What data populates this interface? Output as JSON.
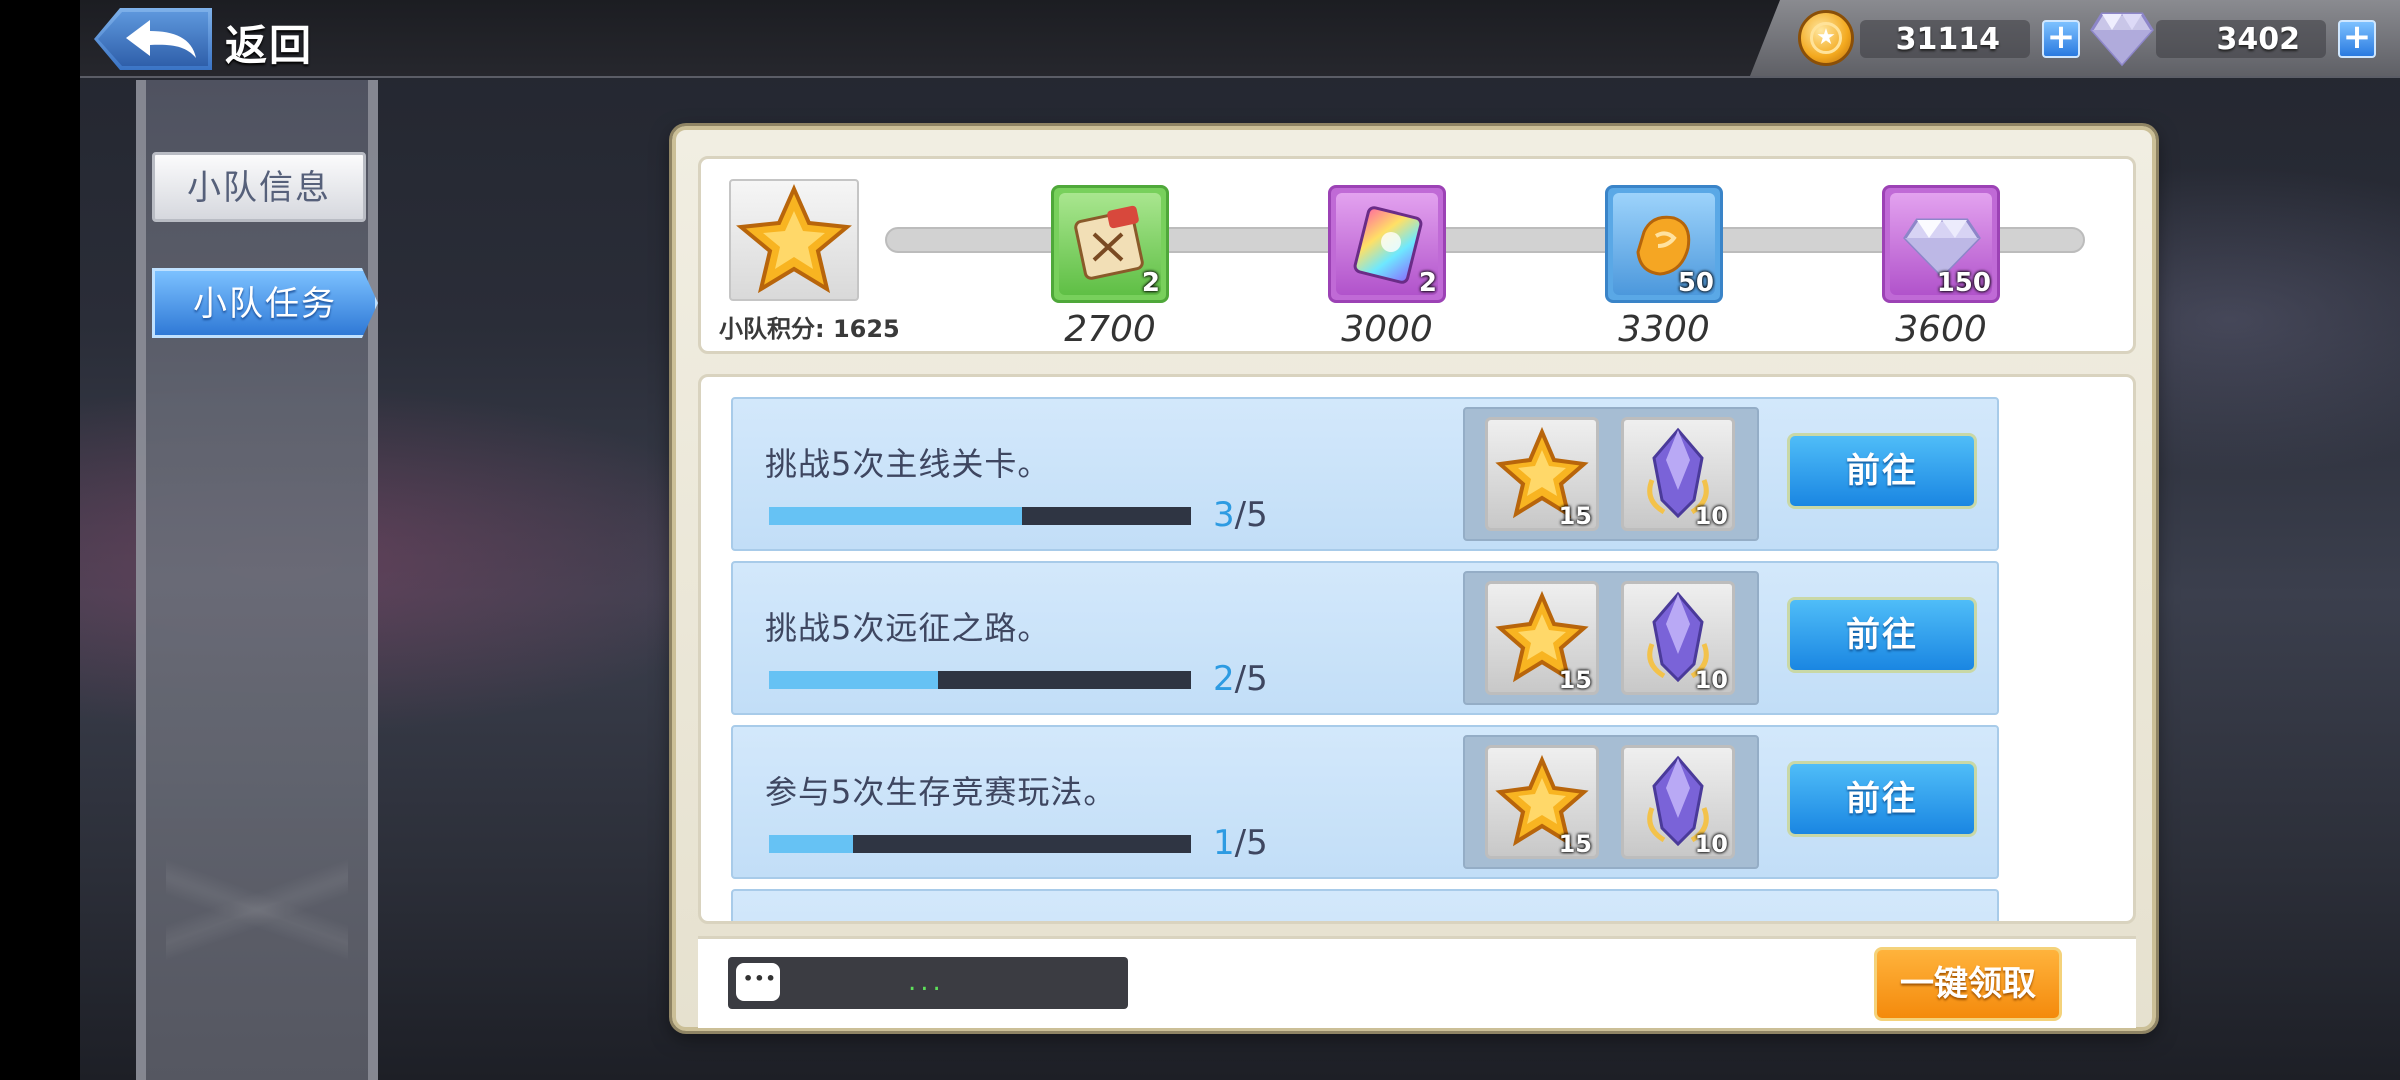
{
  "header": {
    "back_label": "返回",
    "back_icon": "back-arrow-icon",
    "gold": "31114",
    "diamond": "3402"
  },
  "sidebar": {
    "items": [
      {
        "label": "小队信息",
        "active": false
      },
      {
        "label": "小队任务",
        "active": true
      }
    ]
  },
  "rewards": {
    "score_label": "小队积分: 1625",
    "score": 1625,
    "milestones": [
      {
        "threshold": "2700",
        "count": "2",
        "icon": "scroll-icon",
        "frame": "green"
      },
      {
        "threshold": "3000",
        "count": "2",
        "icon": "rainbow-card-icon",
        "frame": "purple"
      },
      {
        "threshold": "3300",
        "count": "50",
        "icon": "ore-icon",
        "frame": "blue"
      },
      {
        "threshold": "3600",
        "count": "150",
        "icon": "diamond-icon",
        "frame": "purple"
      }
    ]
  },
  "tasks": [
    {
      "title": "挑战5次主线关卡。",
      "current": "3",
      "total": "/5",
      "progress": 0.6,
      "rewards": [
        "15",
        "10"
      ],
      "button": "前往"
    },
    {
      "title": "挑战5次远征之路。",
      "current": "2",
      "total": "/5",
      "progress": 0.4,
      "rewards": [
        "15",
        "10"
      ],
      "button": "前往"
    },
    {
      "title": "参与5次生存竞赛玩法。",
      "current": "1",
      "total": "/5",
      "progress": 0.2,
      "rewards": [
        "15",
        "10"
      ],
      "button": "前往"
    }
  ],
  "footer": {
    "chat_dots": "...",
    "claim_all": "一键领取"
  },
  "colors": {
    "accent_blue": "#1a86e2",
    "progress_fill": "#66c2f4",
    "claim_orange": "#f48a0c"
  }
}
